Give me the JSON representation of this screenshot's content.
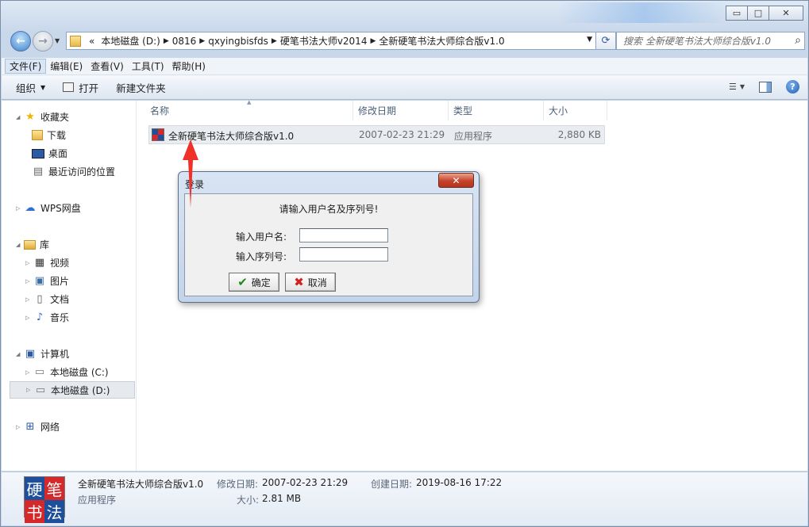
{
  "window": {
    "title_controls": {
      "minimize": "▭",
      "maximize": "□",
      "close": "✕"
    }
  },
  "address": {
    "overflow": "«",
    "segments": [
      "本地磁盘 (D:)",
      "0816",
      "qxyingbisfds",
      "硬笔书法大师v2014",
      "全新硬笔书法大师综合版v1.0"
    ],
    "search_placeholder": "搜索 全新硬笔书法大师综合版v1.0"
  },
  "menu": [
    "文件(F)",
    "编辑(E)",
    "查看(V)",
    "工具(T)",
    "帮助(H)"
  ],
  "commands": {
    "organize": "组织",
    "open": "打开",
    "new_folder": "新建文件夹"
  },
  "nav": {
    "favorites": "收藏夹",
    "downloads": "下载",
    "desktop": "桌面",
    "recent": "最近访问的位置",
    "wps": "WPS网盘",
    "libraries": "库",
    "videos": "视频",
    "pictures": "图片",
    "documents": "文档",
    "music": "音乐",
    "computer": "计算机",
    "drive_c": "本地磁盘 (C:)",
    "drive_d": "本地磁盘 (D:)",
    "network": "网络"
  },
  "columns": {
    "name": "名称",
    "modified": "修改日期",
    "type": "类型",
    "size": "大小"
  },
  "file": {
    "name": "全新硬笔书法大师综合版v1.0",
    "modified": "2007-02-23 21:29",
    "type": "应用程序",
    "size": "2,880 KB"
  },
  "details": {
    "name": "全新硬笔书法大师综合版v1.0",
    "kind": "应用程序",
    "modified_label": "修改日期:",
    "modified_value": "2007-02-23 21:29",
    "created_label": "创建日期:",
    "created_value": "2019-08-16 17:22",
    "size_label": "大小:",
    "size_value": "2.81 MB",
    "icon_chars": [
      "硬",
      "笔",
      "书",
      "法"
    ]
  },
  "dialog": {
    "title": "登录",
    "close": "✕",
    "prompt": "请输入用户名及序列号!",
    "username_label": "输入用户名:",
    "serial_label": "输入序列号:",
    "ok": "确定",
    "cancel": "取消"
  },
  "colors": {
    "arrow": "#f0302a",
    "selection": "#e9ecf0",
    "icon_red": "#d4282a",
    "icon_blue": "#1e4f9c"
  }
}
